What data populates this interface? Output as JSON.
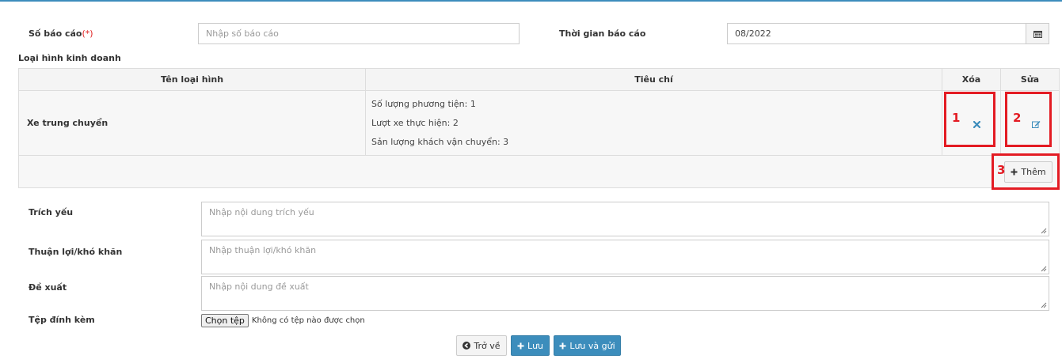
{
  "form": {
    "report_number": {
      "label": "Số báo cáo",
      "required_mark": "(*)",
      "placeholder": "Nhập số báo cáo"
    },
    "report_period": {
      "label": "Thời gian báo cáo",
      "value": "08/2022"
    },
    "business_type_section": "Loại hình kinh doanh",
    "table": {
      "headers": {
        "type_name": "Tên loại hình",
        "criteria": "Tiêu chí",
        "delete": "Xóa",
        "edit": "Sửa"
      },
      "rows": [
        {
          "type_name": "Xe trung chuyển",
          "criteria": [
            "Số lượng phương tiện: 1",
            "Lượt xe thực hiện: 2",
            "Sản lượng khách vận chuyển: 3"
          ]
        }
      ],
      "add_button": "Thêm"
    },
    "summary": {
      "label": "Trích yếu",
      "placeholder": "Nhập nội dung trích yếu"
    },
    "difficulties": {
      "label": "Thuận lợi/khó khăn",
      "placeholder": "Nhập thuận lợi/khó khăn"
    },
    "proposal": {
      "label": "Đề xuất",
      "placeholder": "Nhập nội dung đề xuất"
    },
    "attachment": {
      "label": "Tệp đính kèm",
      "choose_button": "Chọn tệp",
      "no_file_text": "Không có tệp nào được chọn"
    }
  },
  "actions": {
    "back": "Trở về",
    "save": "Lưu",
    "save_and_send": "Lưu và gửi"
  },
  "annotations": [
    "1",
    "2",
    "3"
  ],
  "colors": {
    "annotation": "#e31b23",
    "primary": "#3c8dbc",
    "delete_icon": "#3c8dbc"
  },
  "icons": {
    "calendar": "calendar-icon",
    "delete": "times-icon",
    "edit": "edit-icon",
    "add": "plus-icon",
    "back": "circle-arrow-left-icon"
  }
}
